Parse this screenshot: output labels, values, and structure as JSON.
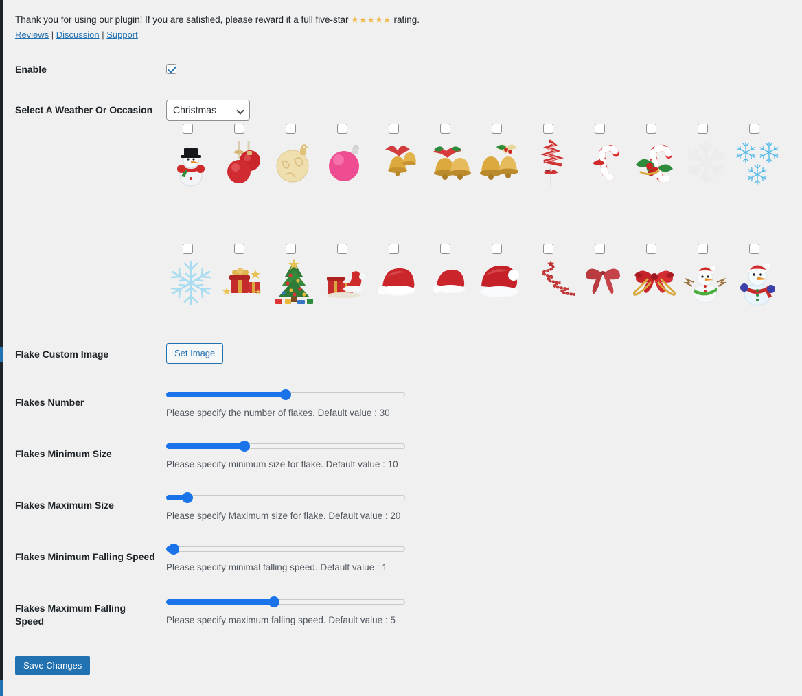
{
  "notice": {
    "text_before": "Thank you for using our plugin! If you are satisfied, please reward it a full five-star ",
    "stars": "★★★★★",
    "text_after": " rating.",
    "links": [
      {
        "label": "Reviews",
        "name": "reviews-link"
      },
      {
        "label": "Discussion",
        "name": "discussion-link"
      },
      {
        "label": "Support",
        "name": "support-link"
      }
    ],
    "separator": " | "
  },
  "fields": {
    "enable": {
      "label": "Enable",
      "checked": true
    },
    "occasion": {
      "label": "Select A Weather Or Occasion",
      "value": "Christmas",
      "options": [
        "Christmas"
      ]
    },
    "custom_image": {
      "label": "Flake Custom Image",
      "button_label": "Set Image"
    }
  },
  "flakes": {
    "rows": [
      [
        {
          "icon": "snowman-tophat",
          "checked": false
        },
        {
          "icon": "red-baubles-hanging",
          "checked": false
        },
        {
          "icon": "gold-ornament-ball",
          "checked": false
        },
        {
          "icon": "pink-ornament-ball",
          "checked": false
        },
        {
          "icon": "gold-bells-red-ribbon",
          "checked": false
        },
        {
          "icon": "gold-bells-holly",
          "checked": false
        },
        {
          "icon": "gold-bells-holly-bow",
          "checked": false
        },
        {
          "icon": "striped-ribbon-tree",
          "checked": false
        },
        {
          "icon": "candy-cane-small",
          "checked": false
        },
        {
          "icon": "candy-cane-holly",
          "checked": false
        },
        {
          "icon": "white-snowflake",
          "checked": false
        },
        {
          "icon": "blue-snowflakes-trio",
          "checked": false
        }
      ],
      [
        {
          "icon": "blue-snowflake-large",
          "checked": false
        },
        {
          "icon": "gift-box-stars",
          "checked": false
        },
        {
          "icon": "decorated-christmas-tree",
          "checked": false
        },
        {
          "icon": "gifts-santa-hat",
          "checked": false
        },
        {
          "icon": "santa-hat-side",
          "checked": false
        },
        {
          "icon": "santa-hat-small",
          "checked": false
        },
        {
          "icon": "santa-hat-pompom",
          "checked": false
        },
        {
          "icon": "beaded-spiral-tree",
          "checked": false
        },
        {
          "icon": "red-ribbon-bow",
          "checked": false
        },
        {
          "icon": "red-gold-bow",
          "checked": false
        },
        {
          "icon": "snowman-green-scarf",
          "checked": false
        },
        {
          "icon": "snowman-red-scarf",
          "checked": false
        }
      ]
    ]
  },
  "sliders": [
    {
      "label": "Flakes Number",
      "help": "Please specify the number of flakes. Default value : 30",
      "percent": 50,
      "name": "flakes-number"
    },
    {
      "label": "Flakes Minimum Size",
      "help": "Please specify minimum size for flake. Default value : 10",
      "percent": 32,
      "name": "flakes-minimum-size"
    },
    {
      "label": "Flakes Maximum Size",
      "help": "Please specify Maximum size for flake. Default value : 20",
      "percent": 7,
      "name": "flakes-maximum-size"
    },
    {
      "label": "Flakes Minimum Falling Speed",
      "help": "Please specify minimal falling speed. Default value : 1",
      "percent": 1,
      "name": "flakes-minimum-falling-speed"
    },
    {
      "label": "Flakes Maximum Falling Speed",
      "help": "Please specify maximum falling speed. Default value : 5",
      "percent": 45,
      "name": "flakes-maximum-falling-speed"
    }
  ],
  "save": {
    "label": "Save Changes"
  },
  "colors": {
    "accent": "#2271b1",
    "slider": "#1a73e8",
    "star": "#f0b849",
    "background": "#f0f0f1",
    "rail": "#1d2327"
  }
}
